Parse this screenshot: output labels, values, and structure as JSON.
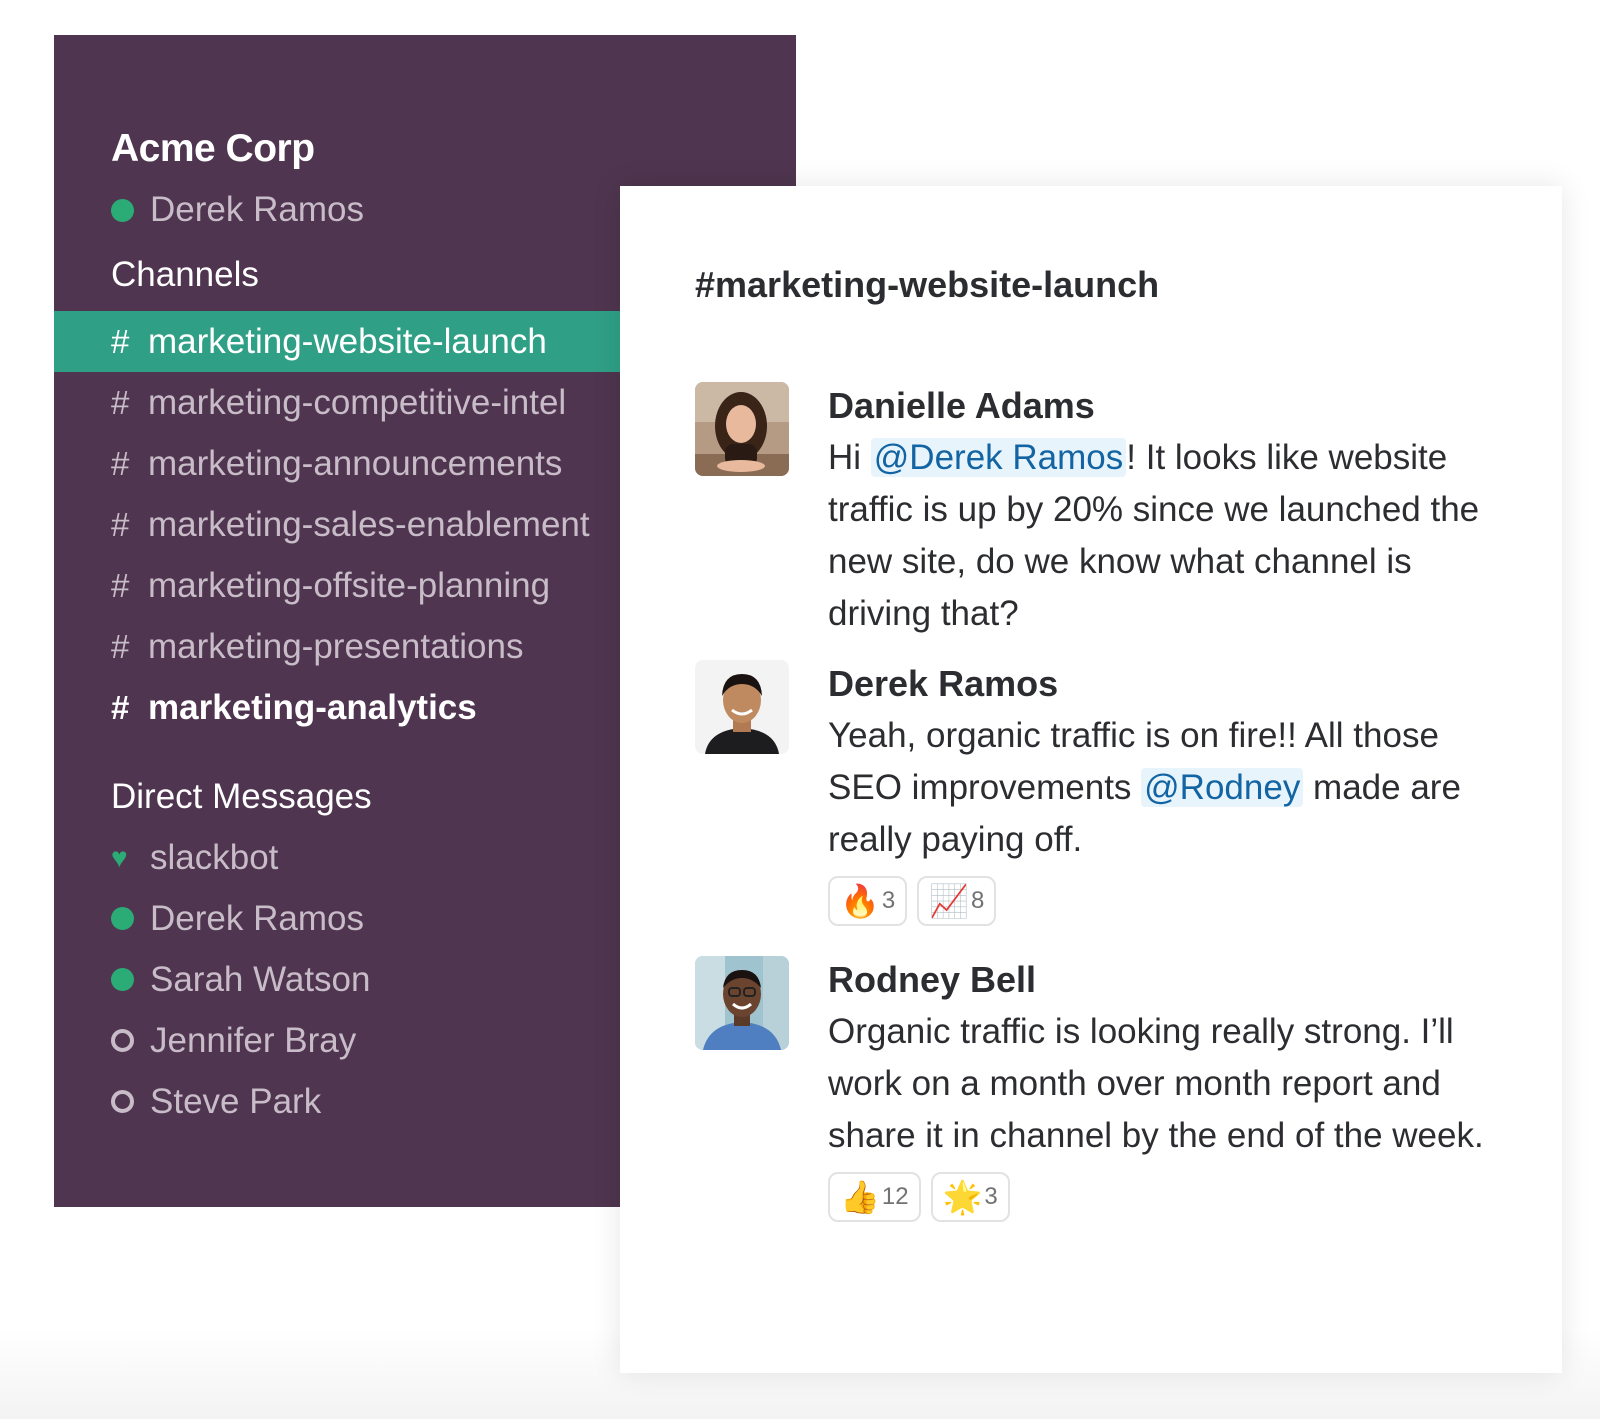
{
  "workspace": {
    "team_name": "Acme Corp",
    "current_user": "Derek Ramos"
  },
  "sidebar": {
    "channels_header": "Channels",
    "channels": [
      {
        "hash": "#",
        "name": "marketing-website-launch",
        "state": "active"
      },
      {
        "hash": "#",
        "name": "marketing-competitive-intel",
        "state": "normal"
      },
      {
        "hash": "#",
        "name": "marketing-announcements",
        "state": "normal"
      },
      {
        "hash": "#",
        "name": "marketing-sales-enablement",
        "state": "normal"
      },
      {
        "hash": "#",
        "name": "marketing-offsite-planning",
        "state": "normal"
      },
      {
        "hash": "#",
        "name": "marketing-presentations",
        "state": "normal"
      },
      {
        "hash": "#",
        "name": "marketing-analytics",
        "state": "unread"
      }
    ],
    "dm_header": "Direct Messages",
    "direct_messages": [
      {
        "name": "slackbot",
        "presence": "heart"
      },
      {
        "name": "Derek Ramos",
        "presence": "active"
      },
      {
        "name": "Sarah Watson",
        "presence": "active"
      },
      {
        "name": "Jennifer Bray",
        "presence": "away"
      },
      {
        "name": "Steve Park",
        "presence": "away"
      }
    ]
  },
  "chat": {
    "channel_title": "#marketing-website-launch",
    "messages": [
      {
        "sender": "Danielle Adams",
        "avatar_icon": "danielle-avatar",
        "pre": "Hi ",
        "mention": "@Derek Ramos",
        "post": "! It looks like website traffic is up by 20% since we launched the new site, do we know what channel is driving that?",
        "reactions": []
      },
      {
        "sender": "Derek Ramos",
        "avatar_icon": "derek-avatar",
        "pre": "Yeah, organic traffic is on fire!! All those SEO improvements ",
        "mention": "@Rodney",
        "post": " made are really paying off.",
        "reactions": [
          {
            "emoji": "🔥",
            "icon": "fire-emoji-icon",
            "count": "3"
          },
          {
            "emoji": "📈",
            "icon": "chart-increasing-emoji-icon",
            "count": "8"
          }
        ]
      },
      {
        "sender": "Rodney Bell",
        "avatar_icon": "rodney-avatar",
        "pre": "Organic traffic is looking really strong. I’ll work on a month over month report and share it in channel by the end of the week.",
        "mention": "",
        "post": "",
        "reactions": [
          {
            "emoji": "👍",
            "icon": "thumbs-up-emoji-icon",
            "count": "12"
          },
          {
            "emoji": "🌟",
            "icon": "glowing-star-emoji-icon",
            "count": "3"
          }
        ]
      }
    ]
  },
  "colors": {
    "sidebar_bg": "#4f354f",
    "active_channel_bg": "#2f9f86",
    "presence_green": "#2bac76",
    "mention_blue": "#1264a3",
    "mention_bg": "#e8f4fc"
  }
}
